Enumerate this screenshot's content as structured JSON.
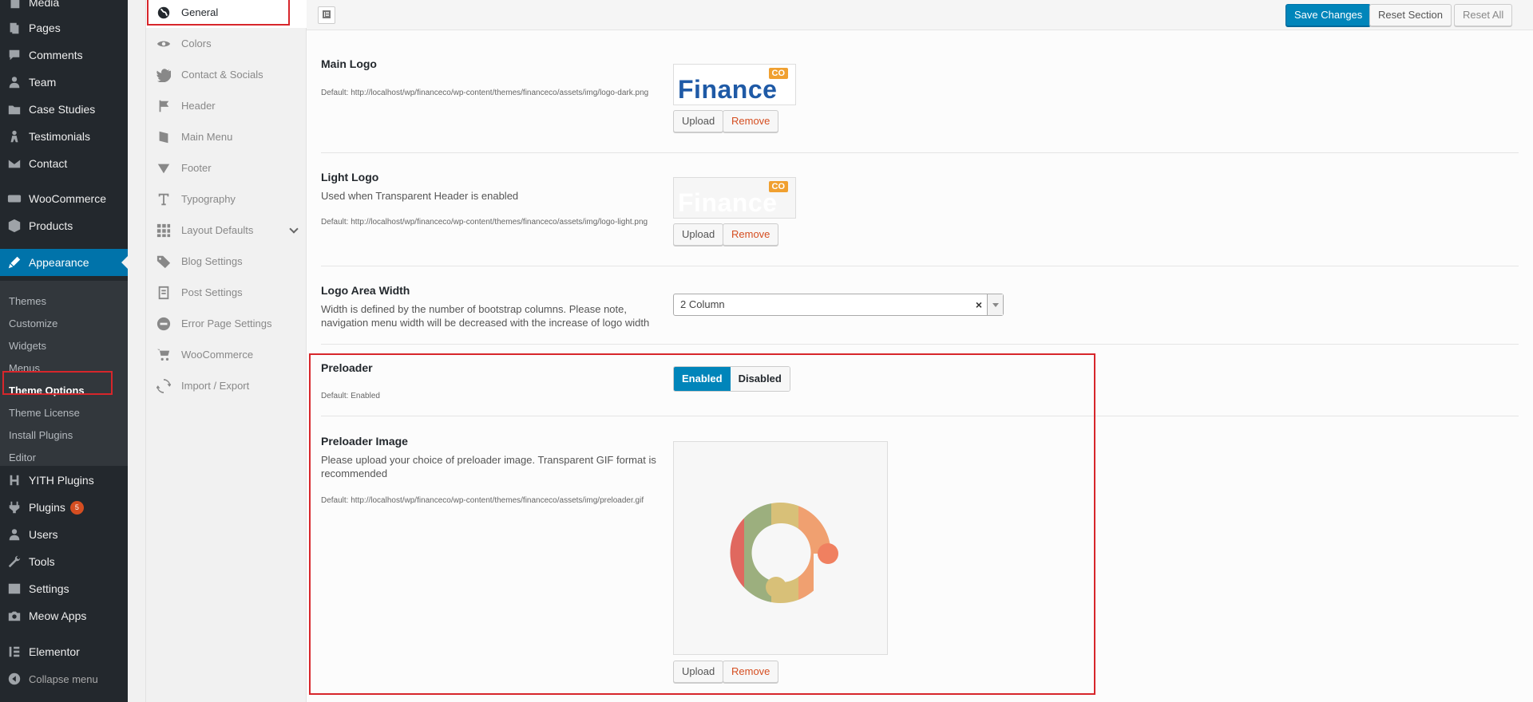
{
  "sidebar": {
    "items": [
      {
        "label": "Media",
        "icon": "media-icon"
      },
      {
        "label": "Pages",
        "icon": "pages-icon"
      },
      {
        "label": "Comments",
        "icon": "comments-icon"
      },
      {
        "label": "Team",
        "icon": "team-icon"
      },
      {
        "label": "Case Studies",
        "icon": "case-studies-icon"
      },
      {
        "label": "Testimonials",
        "icon": "testimonials-icon"
      },
      {
        "label": "Contact",
        "icon": "contact-icon"
      },
      {
        "label": "WooCommerce",
        "icon": "woocommerce-icon"
      },
      {
        "label": "Products",
        "icon": "products-icon"
      },
      {
        "label": "Appearance",
        "icon": "appearance-icon"
      },
      {
        "label": "YITH Plugins",
        "icon": "yith-icon"
      },
      {
        "label": "Plugins",
        "icon": "plugins-icon",
        "badge": "5"
      },
      {
        "label": "Users",
        "icon": "users-icon"
      },
      {
        "label": "Tools",
        "icon": "tools-icon"
      },
      {
        "label": "Settings",
        "icon": "settings-icon"
      },
      {
        "label": "Meow Apps",
        "icon": "camera-icon"
      },
      {
        "label": "Elementor",
        "icon": "elementor-icon"
      },
      {
        "label": "Collapse menu",
        "icon": "collapse-icon"
      }
    ],
    "submenu": [
      "Themes",
      "Customize",
      "Widgets",
      "Menus",
      "Theme Options",
      "Theme License",
      "Install Plugins",
      "Editor"
    ],
    "active_color": "#0073aa"
  },
  "options_nav": [
    {
      "label": "General",
      "icon": "globe-icon"
    },
    {
      "label": "Colors",
      "icon": "eye-icon"
    },
    {
      "label": "Contact & Socials",
      "icon": "twitter-icon"
    },
    {
      "label": "Header",
      "icon": "flag-icon"
    },
    {
      "label": "Main Menu",
      "icon": "book-icon"
    },
    {
      "label": "Footer",
      "icon": "triangle-down-icon"
    },
    {
      "label": "Typography",
      "icon": "text-icon"
    },
    {
      "label": "Layout Defaults",
      "icon": "grid-icon"
    },
    {
      "label": "Blog Settings",
      "icon": "tags-icon"
    },
    {
      "label": "Post Settings",
      "icon": "post-icon"
    },
    {
      "label": "Error Page Settings",
      "icon": "minus-circle-icon"
    },
    {
      "label": "WooCommerce",
      "icon": "cart-icon"
    },
    {
      "label": "Import / Export",
      "icon": "refresh-icon"
    }
  ],
  "toolbar": {
    "save": "Save Changes",
    "reset_section": "Reset Section",
    "reset_all": "Reset All"
  },
  "fields": {
    "main_logo": {
      "title": "Main Logo",
      "default": "Default: http://localhost/wp/financeco/wp-content/themes/financeco/assets/img/logo-dark.png",
      "logo_word": "Finance",
      "logo_badge": "CO",
      "upload": "Upload",
      "remove": "Remove"
    },
    "light_logo": {
      "title": "Light Logo",
      "subtitle": "Used when Transparent Header is enabled",
      "default": "Default: http://localhost/wp/financeco/wp-content/themes/financeco/assets/img/logo-light.png",
      "logo_word": "Finance",
      "logo_badge": "CO",
      "upload": "Upload",
      "remove": "Remove"
    },
    "logo_width": {
      "title": "Logo Area Width",
      "subtitle": "Width is defined by the number of bootstrap columns. Please note, navigation menu width will be decreased with the increase of logo width",
      "value": "2 Column",
      "clear": "×"
    },
    "preloader": {
      "title": "Preloader",
      "default": "Default: Enabled",
      "on": "Enabled",
      "off": "Disabled"
    },
    "preloader_image": {
      "title": "Preloader Image",
      "subtitle": "Please upload your choice of preloader image. Transparent GIF format is recommended",
      "default": "Default: http://localhost/wp/financeco/wp-content/themes/financeco/assets/img/preloader.gif",
      "upload": "Upload",
      "remove": "Remove"
    }
  },
  "colors": {
    "brand_blue": "#1f5aa6",
    "badge_orange": "#f0a030",
    "highlight_red": "#d7262b"
  }
}
